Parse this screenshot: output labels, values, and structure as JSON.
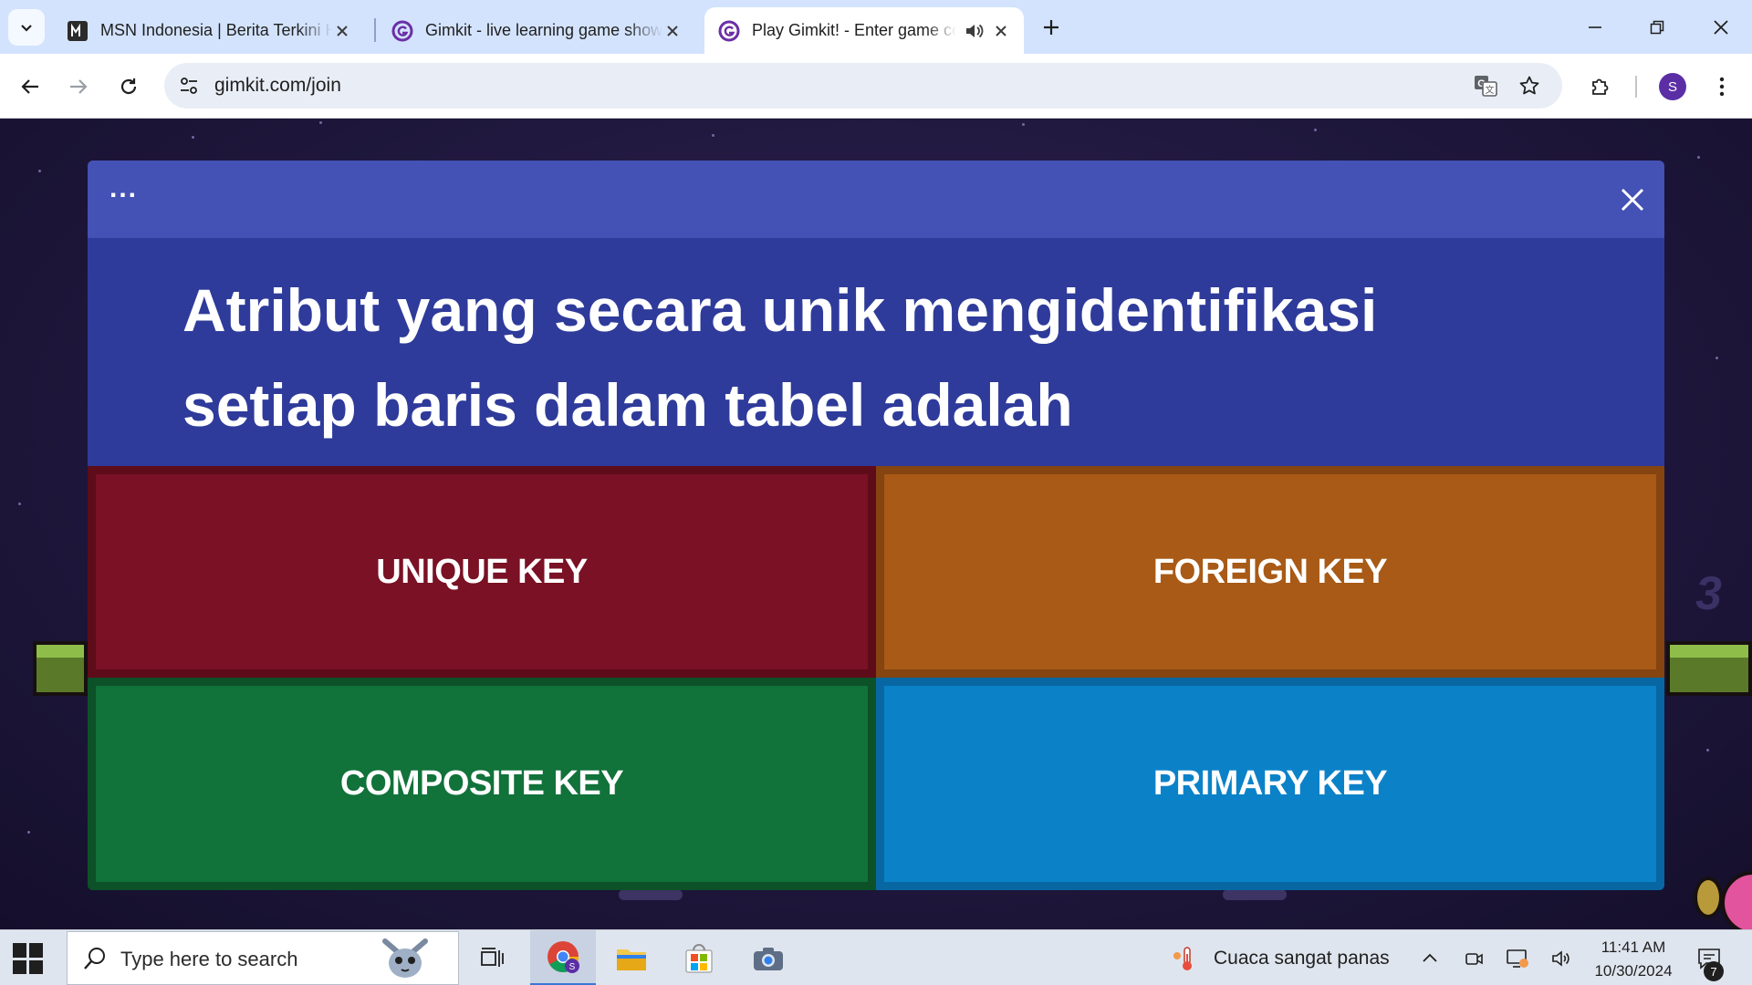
{
  "browser": {
    "tabs": [
      {
        "title": "MSN Indonesia | Berita Terkini Hari Ini",
        "favicon": "msn-icon",
        "active": false
      },
      {
        "title": "Gimkit - live learning game show",
        "favicon": "gimkit-icon",
        "active": false
      },
      {
        "title": "Play Gimkit! - Enter game code",
        "favicon": "gimkit-icon",
        "active": true,
        "audio": true
      }
    ],
    "url": "gimkit.com/join",
    "profile_initial": "S"
  },
  "game": {
    "menu_label": "...",
    "question": "Atribut yang secara unik mengidentifikasi setiap baris dalam tabel adalah",
    "answers": [
      {
        "label": "UNIQUE KEY",
        "color": "#7a1124"
      },
      {
        "label": "FOREIGN KEY",
        "color": "#a85a16"
      },
      {
        "label": "COMPOSITE KEY",
        "color": "#11723a"
      },
      {
        "label": "PRIMARY KEY",
        "color": "#0b82c8"
      }
    ],
    "background_number": "3"
  },
  "taskbar": {
    "search_placeholder": "Type here to search",
    "weather": "Cuaca sangat panas",
    "time": "11:41 AM",
    "date": "10/30/2024",
    "notification_count": "7"
  }
}
